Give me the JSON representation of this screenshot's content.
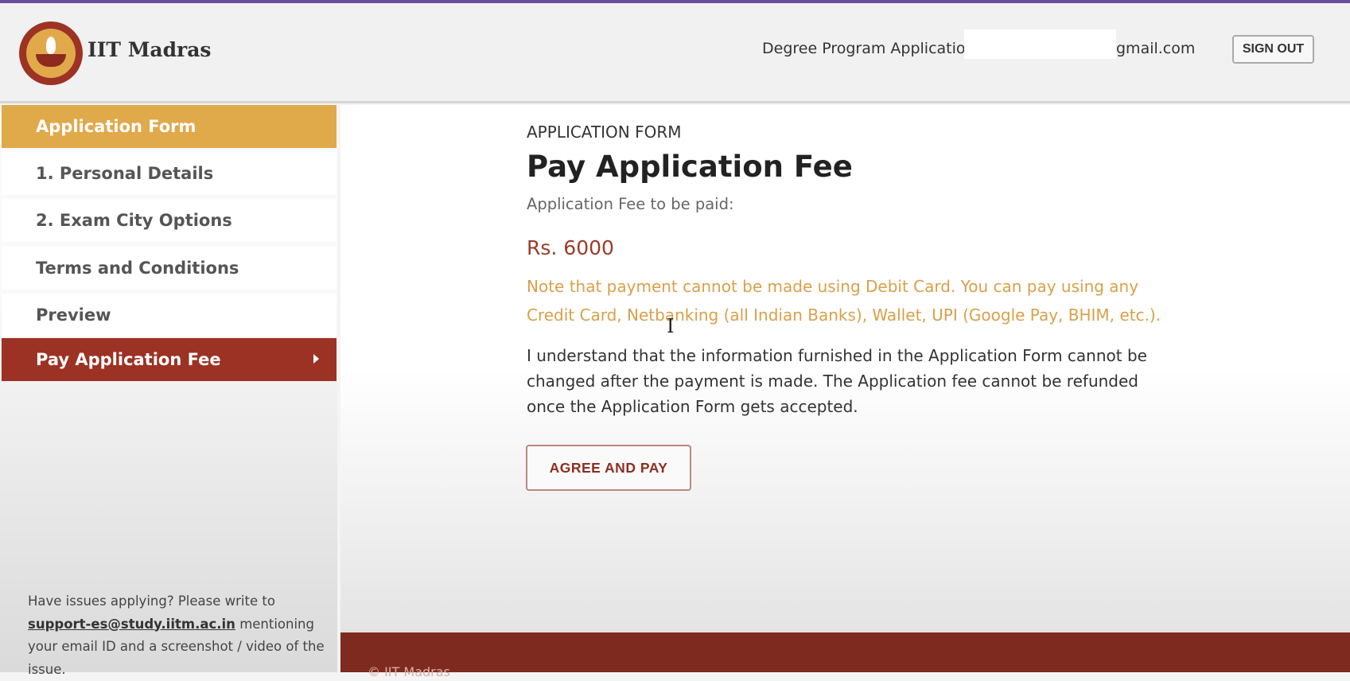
{
  "header": {
    "brand": "IIT Madras",
    "app_label": "Degree Program Application",
    "email_suffix": "gmail.com",
    "signout": "SIGN OUT"
  },
  "sidebar": {
    "items": [
      {
        "label": "Application Form"
      },
      {
        "label": "1. Personal Details"
      },
      {
        "label": "2. Exam City Options"
      },
      {
        "label": "Terms and Conditions"
      },
      {
        "label": "Preview"
      },
      {
        "label": "Pay Application Fee"
      }
    ],
    "help_prefix": "Have issues applying? Please write to",
    "help_email": "support-es@study.iitm.ac.in",
    "help_suffix": "mentioning your email ID and a screenshot / video of the issue."
  },
  "main": {
    "kicker": "APPLICATION FORM",
    "title": "Pay Application Fee",
    "fee_label": "Application Fee to be paid:",
    "amount": "Rs. 6000",
    "note": "Note that payment cannot be made using Debit Card. You can pay using any Credit Card, Netbanking (all Indian Banks), Wallet, UPI (Google Pay, BHIM, etc.).",
    "declaration": "I understand that the information furnished in the Application Form cannot be changed after the payment is made. The Application fee cannot be refunded once the Application Form gets accepted.",
    "agree_button": "AGREE AND PAY"
  },
  "footer": {
    "copyright": "© IIT Madras"
  },
  "colors": {
    "gold": "#e0a94a",
    "maroon": "#9c3223",
    "footer": "#7e2a1f",
    "accent_top": "#6b4ea0"
  }
}
